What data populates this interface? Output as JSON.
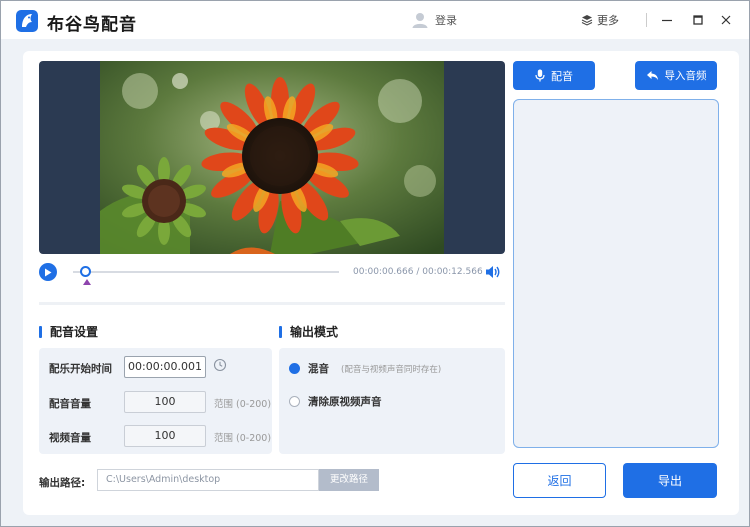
{
  "titlebar": {
    "app_title": "布谷鸟配音",
    "login_label": "登录",
    "more_label": "更多"
  },
  "player": {
    "timecode": "00:00:00.666 / 00:00:12.566",
    "progress_fraction": 0.053
  },
  "settings": {
    "title": "配音设置",
    "music_start_label": "配乐开始时间",
    "music_start_value": "00:00:00.001",
    "dub_volume_label": "配音音量",
    "dub_volume_value": "100",
    "dub_volume_range": "范围 (0-200)",
    "video_volume_label": "视频音量",
    "video_volume_value": "100",
    "video_volume_range": "范围 (0-200)"
  },
  "output_mode": {
    "title": "输出模式",
    "options": [
      {
        "label": "混音",
        "hint": "(配音与视频声音同时存在)",
        "selected": true
      },
      {
        "label": "清除原视频声音",
        "hint": "",
        "selected": false
      }
    ]
  },
  "path": {
    "label": "输出路径:",
    "value": "C:\\Users\\Admin\\desktop",
    "change_button": "更改路径"
  },
  "side": {
    "dub_button": "配音",
    "import_button": "导入音频",
    "back_button": "返回",
    "export_button": "导出"
  },
  "colors": {
    "accent": "#1f6fe5",
    "panel": "#eef2f8",
    "video_bg": "#2b3a52"
  }
}
